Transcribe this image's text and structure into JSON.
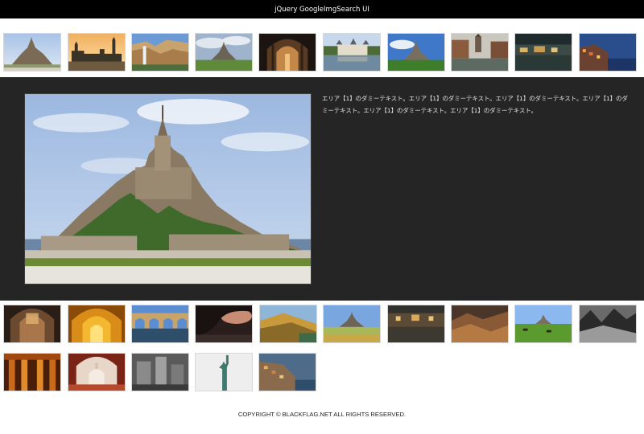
{
  "header": {
    "title": "jQuery GoogleImgSearch UI"
  },
  "gallery_top": {
    "thumbnails": [
      {
        "subject": "mont-saint-michel"
      },
      {
        "subject": "palace-westminster"
      },
      {
        "subject": "canyon-waterfall"
      },
      {
        "subject": "mont-saint-michel-field"
      },
      {
        "subject": "cathedral-interior"
      },
      {
        "subject": "chateau-chenonceau"
      },
      {
        "subject": "mont-saint-michel-green"
      },
      {
        "subject": "canal-town"
      },
      {
        "subject": "night-waterfront"
      },
      {
        "subject": "coastal-village-dusk"
      }
    ]
  },
  "feature": {
    "image_subject": "mont-saint-michel",
    "description": "エリア【1】のダミーテキスト。エリア【1】のダミーテキスト。エリア【1】のダミーテキスト。エリア【1】のダミーテキスト。エリア【1】のダミーテキスト。エリア【1】のダミーテキスト。"
  },
  "gallery_bottom": {
    "thumbnails": [
      {
        "subject": "gothic-interior"
      },
      {
        "subject": "golden-arches"
      },
      {
        "subject": "aqueduct-bridge"
      },
      {
        "subject": "cave-sunset"
      },
      {
        "subject": "golden-hillside"
      },
      {
        "subject": "mont-saint-michel-meadow"
      },
      {
        "subject": "riverside-night"
      },
      {
        "subject": "desert-rocks"
      },
      {
        "subject": "mont-saint-michel-pasture"
      },
      {
        "subject": "mountain-valley-bw"
      },
      {
        "subject": "temple-interior"
      },
      {
        "subject": "taj-mahal-arch"
      },
      {
        "subject": "ruins-bw"
      },
      {
        "subject": "statue-of-liberty"
      },
      {
        "subject": "cliff-village"
      }
    ]
  },
  "footer": {
    "copyright": "COPYRIGHT © BLACKFLAG.NET ALL RIGHTS RESERVED."
  },
  "colors": {
    "topbar": "#000000",
    "feature_background": "#252525",
    "page_background": "#ffffff"
  }
}
